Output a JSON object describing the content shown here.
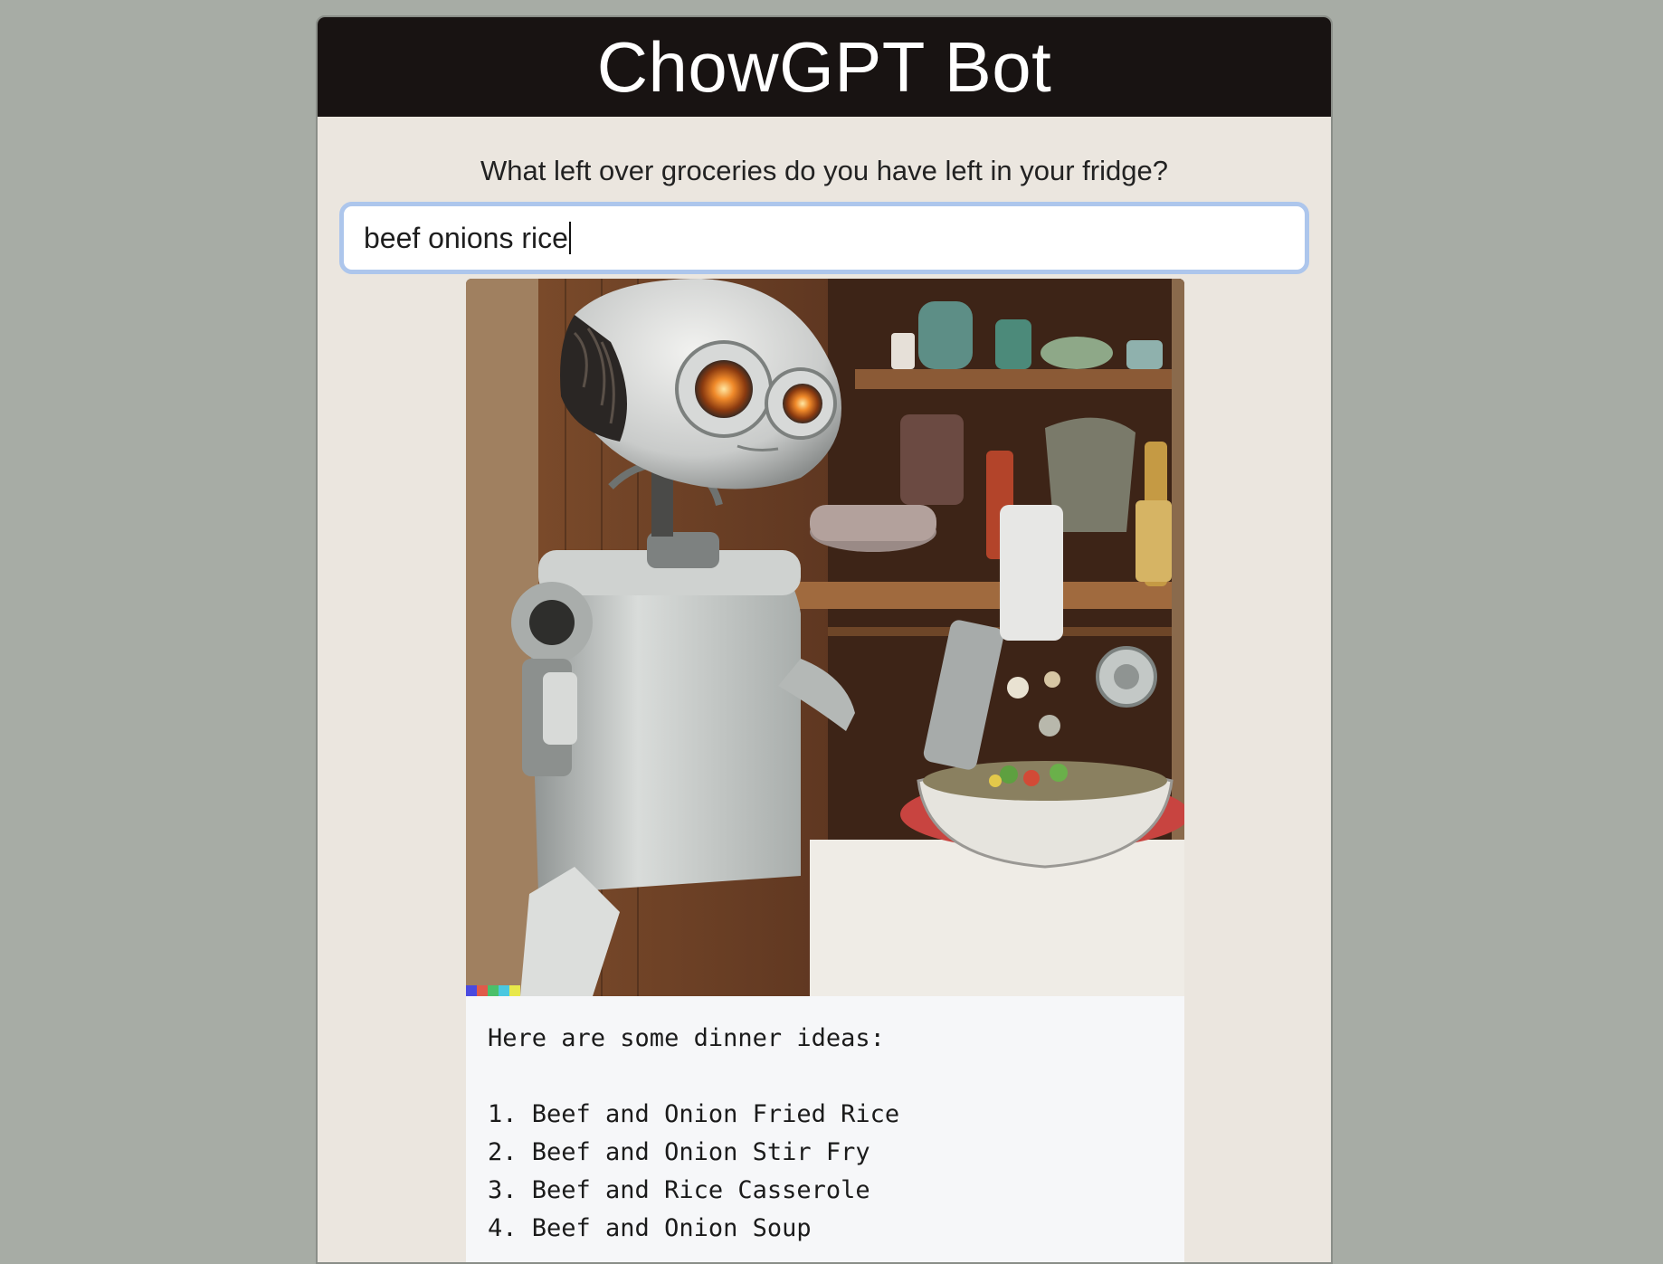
{
  "header": {
    "title": "ChowGPT Bot"
  },
  "form": {
    "question": "What left over groceries do you have left in your fridge?",
    "input_value": "beef onions rice"
  },
  "illustration": {
    "subject": "robot-chef-image"
  },
  "response": {
    "intro": "Here are some dinner ideas:",
    "ideas": [
      "1. Beef and Onion Fried Rice",
      "2. Beef and Onion Stir Fry",
      "3. Beef and Rice Casserole",
      "4. Beef and Onion Soup"
    ]
  },
  "colors": {
    "page_background": "#a7aca5",
    "header_background": "#181312",
    "panel_background": "#ebe6df",
    "input_focus_ring": "#adc6ec"
  }
}
